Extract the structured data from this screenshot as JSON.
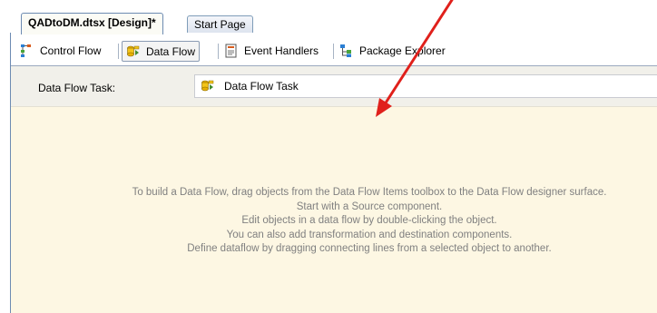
{
  "document_tabs": [
    {
      "label": "QADtoDM.dtsx [Design]*",
      "active": true
    },
    {
      "label": "Start Page",
      "active": false
    }
  ],
  "designer_tabs": [
    {
      "label": "Control Flow",
      "icon": "control-flow-icon",
      "selected": false
    },
    {
      "label": "Data Flow",
      "icon": "data-flow-icon",
      "selected": true
    },
    {
      "label": "Event Handlers",
      "icon": "event-handlers-icon",
      "selected": false
    },
    {
      "label": "Package Explorer",
      "icon": "package-explorer-icon",
      "selected": false
    }
  ],
  "task_bar": {
    "label": "Data Flow Task:",
    "selected_task": "Data Flow Task"
  },
  "surface_hint": {
    "lines": [
      "To build a Data Flow, drag objects from the Data Flow Items toolbox to the Data Flow designer surface.",
      "Start with a Source component.",
      "Edit objects in a data flow by double-clicking the object.",
      "You can also add transformation and destination components.",
      "Define dataflow by dragging connecting lines from a selected object to another."
    ]
  },
  "colors": {
    "surface": "#fdf7e3",
    "annotation_arrow": "#e0201b",
    "hint_text": "#808080",
    "tab_border": "#6d8bb2"
  }
}
